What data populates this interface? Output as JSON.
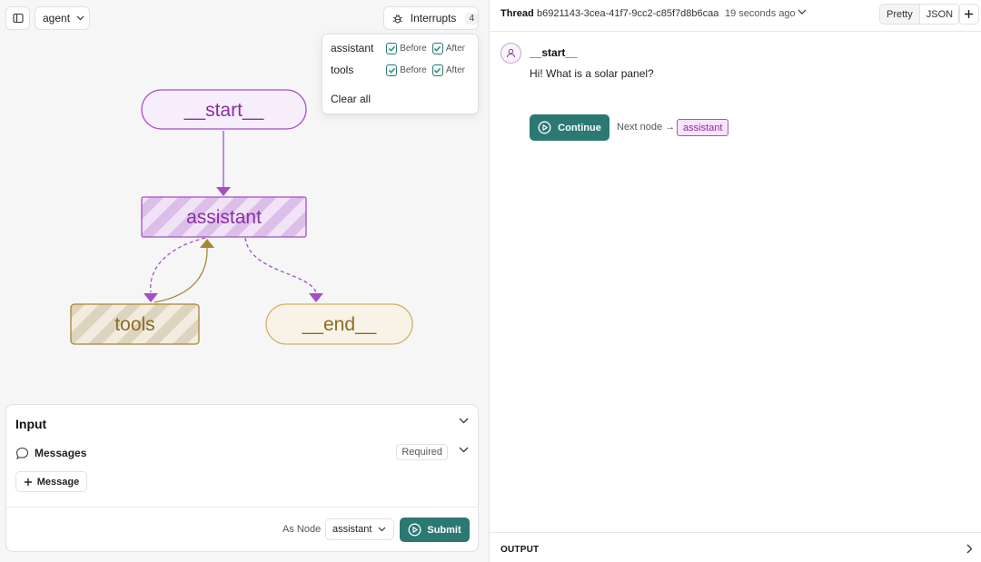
{
  "toolbar": {
    "agent_label": "agent",
    "interrupts_label": "Interrupts",
    "interrupts_count": "4"
  },
  "interrupts_menu": {
    "rows": [
      {
        "node": "assistant",
        "before_label": "Before",
        "after_label": "After",
        "before_checked": true,
        "after_checked": true
      },
      {
        "node": "tools",
        "before_label": "Before",
        "after_label": "After",
        "before_checked": true,
        "after_checked": true
      }
    ],
    "clear_label": "Clear all"
  },
  "graph": {
    "nodes": {
      "start": "__start__",
      "assistant": "assistant",
      "tools": "tools",
      "end": "__end__"
    },
    "colors": {
      "purple": "#9b3fc2",
      "purple_fill": "#f5ecf9",
      "gold": "#a58637",
      "gold_fill": "#f6f0e3"
    }
  },
  "input": {
    "title": "Input",
    "messages_label": "Messages",
    "required_label": "Required",
    "add_message_label": "Message",
    "as_node_label": "As Node",
    "node_value": "assistant",
    "submit_label": "Submit"
  },
  "thread": {
    "label": "Thread",
    "id": "b6921143-3cea-41f7-9cc2-c85f7d8b6caa",
    "time": "19 seconds ago",
    "view_pretty": "Pretty",
    "view_json": "JSON",
    "node_name": "__start__",
    "message": "Hi! What is a solar panel?",
    "continue_label": "Continue",
    "next_node_label": "Next node →",
    "next_node_value": "assistant",
    "output_label": "OUTPUT"
  },
  "accent": "#2c7873"
}
